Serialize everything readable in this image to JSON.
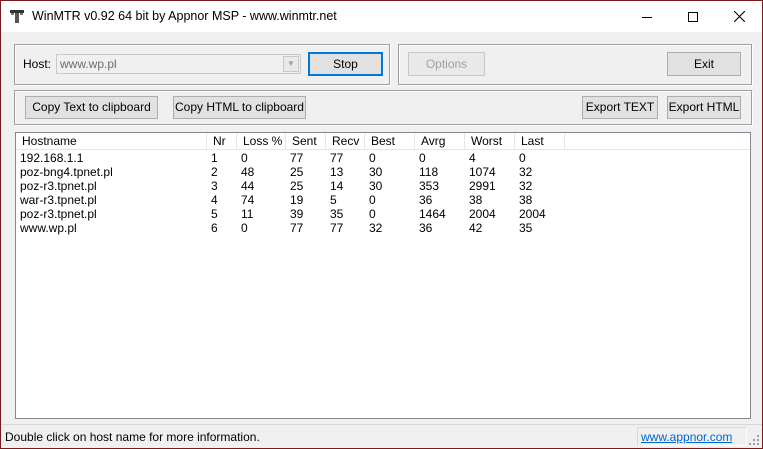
{
  "window": {
    "title": "WinMTR v0.92 64 bit by Appnor MSP - www.winmtr.net"
  },
  "controls": {
    "host_label": "Host:",
    "host_value": "www.wp.pl",
    "stop_label": "Stop",
    "options_label": "Options",
    "exit_label": "Exit",
    "copy_text_label": "Copy Text to clipboard",
    "copy_html_label": "Copy HTML to clipboard",
    "export_text_label": "Export TEXT",
    "export_html_label": "Export HTML"
  },
  "table": {
    "columns": [
      "Hostname",
      "Nr",
      "Loss %",
      "Sent",
      "Recv",
      "Best",
      "Avrg",
      "Worst",
      "Last"
    ],
    "rows": [
      [
        "192.168.1.1",
        "1",
        "0",
        "77",
        "77",
        "0",
        "0",
        "4",
        "0"
      ],
      [
        "poz-bng4.tpnet.pl",
        "2",
        "48",
        "25",
        "13",
        "30",
        "118",
        "1074",
        "32"
      ],
      [
        "poz-r3.tpnet.pl",
        "3",
        "44",
        "25",
        "14",
        "30",
        "353",
        "2991",
        "32"
      ],
      [
        "war-r3.tpnet.pl",
        "4",
        "74",
        "19",
        "5",
        "0",
        "36",
        "38",
        "38"
      ],
      [
        "poz-r3.tpnet.pl",
        "5",
        "11",
        "39",
        "35",
        "0",
        "1464",
        "2004",
        "2004"
      ],
      [
        "www.wp.pl",
        "6",
        "0",
        "77",
        "77",
        "32",
        "36",
        "42",
        "35"
      ]
    ]
  },
  "status": {
    "message": "Double click on host name for more information.",
    "link": "www.appnor.com"
  },
  "icons": {
    "app": "winmtr-app-icon",
    "minimize": "minimize-icon",
    "maximize": "maximize-icon",
    "close": "close-icon",
    "combo": "chevron-down-icon",
    "grip": "resize-grip-icon"
  }
}
